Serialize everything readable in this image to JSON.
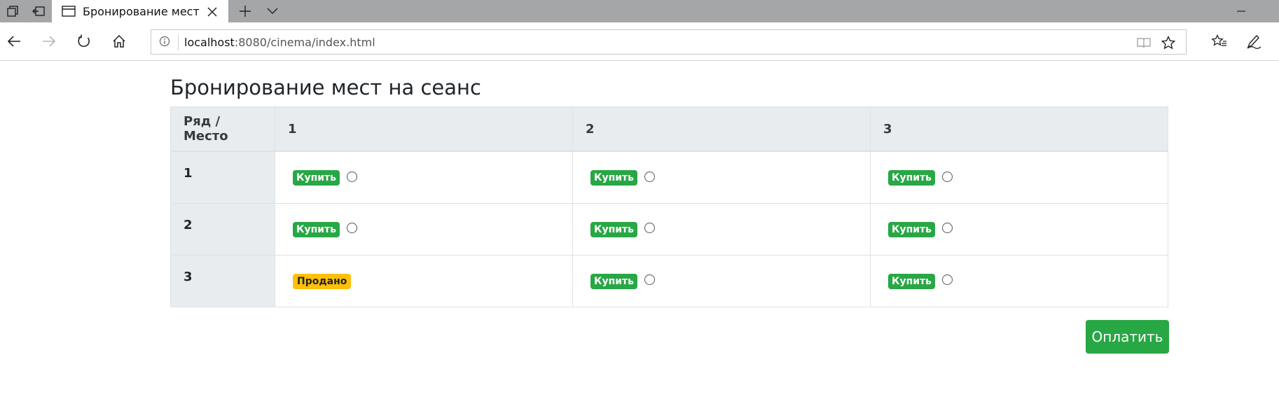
{
  "browser": {
    "tab_title": "Бронирование мест",
    "url_host": "localhost",
    "url_rest": ":8080/cinema/index.html"
  },
  "page": {
    "title": "Бронирование мест на сеанс",
    "header_corner": "Ряд / Место",
    "columns": [
      "1",
      "2",
      "3"
    ],
    "rows": [
      {
        "label": "1",
        "seats": [
          {
            "status": "buy",
            "label": "Купить"
          },
          {
            "status": "buy",
            "label": "Купить"
          },
          {
            "status": "buy",
            "label": "Купить"
          }
        ]
      },
      {
        "label": "2",
        "seats": [
          {
            "status": "buy",
            "label": "Купить"
          },
          {
            "status": "buy",
            "label": "Купить"
          },
          {
            "status": "buy",
            "label": "Купить"
          }
        ]
      },
      {
        "label": "3",
        "seats": [
          {
            "status": "sold",
            "label": "Продано"
          },
          {
            "status": "buy",
            "label": "Купить"
          },
          {
            "status": "buy",
            "label": "Купить"
          }
        ]
      }
    ],
    "pay_button": "Оплатить"
  },
  "colors": {
    "success": "#28a745",
    "warning": "#ffc107",
    "header_bg": "#e9ecef",
    "tabstrip_bg": "#a5a6a8"
  },
  "icons": [
    "tab-list-icon",
    "tab-aside-icon",
    "page-icon",
    "close-icon",
    "plus-icon",
    "chevron-down-icon",
    "minimize-icon",
    "back-arrow-icon",
    "forward-arrow-icon",
    "refresh-icon",
    "home-icon",
    "info-icon",
    "reading-view-icon",
    "star-icon",
    "favorites-icon",
    "pen-icon"
  ]
}
